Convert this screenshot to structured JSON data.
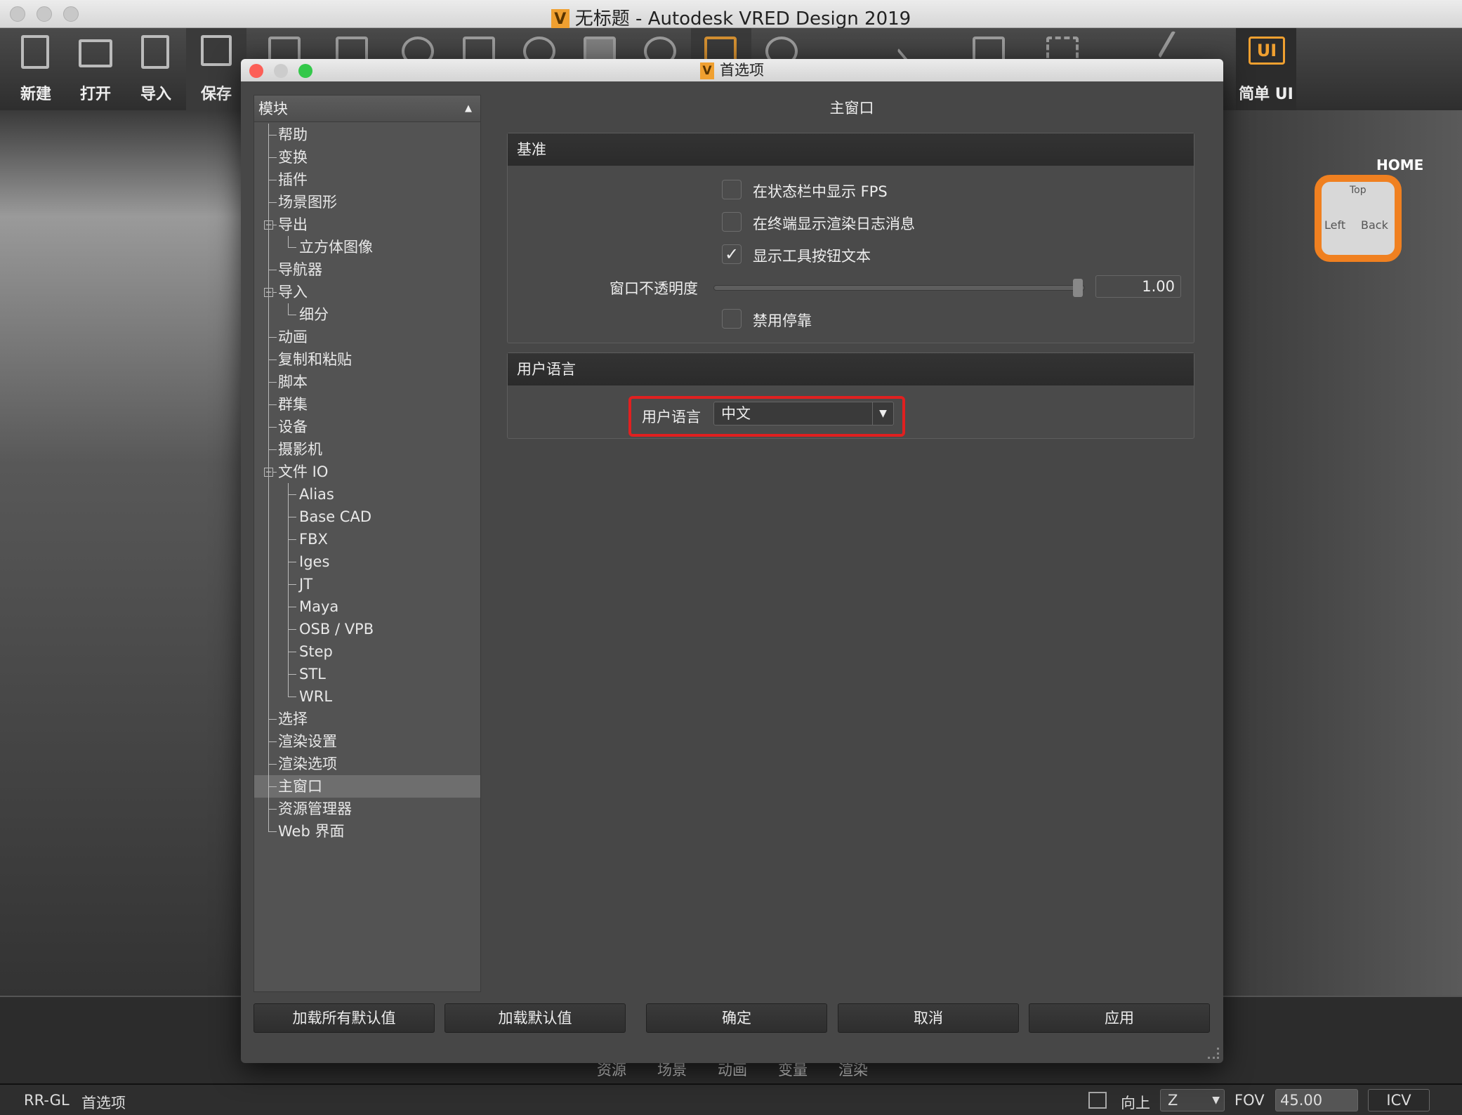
{
  "window": {
    "title": "无标题 - Autodesk VRED Design 2019",
    "logo": "V"
  },
  "toolbar": {
    "buttons": [
      {
        "label": "新建",
        "icon": "new-file-icon"
      },
      {
        "label": "打开",
        "icon": "folder-open-icon"
      },
      {
        "label": "导入",
        "icon": "import-icon"
      },
      {
        "label": "保存",
        "icon": "save-icon"
      }
    ],
    "simple_ui_label": "简单 UI",
    "simple_ui_icon": "UI"
  },
  "viewport": {
    "navcube_home": "HOME",
    "navcube_faces": [
      "Top",
      "Left",
      "Back"
    ]
  },
  "bottom_tabs": [
    "资源",
    "场景",
    "动画",
    "变量",
    "渲染"
  ],
  "status": {
    "renderer": "RR-GL",
    "message": "首选项",
    "up_label": "向上",
    "up_value": "Z",
    "fov_label": "FOV",
    "fov_value": "45.00",
    "icv": "ICV"
  },
  "dialog": {
    "title": "首选项",
    "tree": {
      "header": "模块",
      "items": [
        {
          "label": "帮助",
          "level": 0
        },
        {
          "label": "变换",
          "level": 0
        },
        {
          "label": "插件",
          "level": 0
        },
        {
          "label": "场景图形",
          "level": 0
        },
        {
          "label": "导出",
          "level": 0,
          "expanded": true
        },
        {
          "label": "立方体图像",
          "level": 1
        },
        {
          "label": "导航器",
          "level": 0
        },
        {
          "label": "导入",
          "level": 0,
          "expanded": true
        },
        {
          "label": "细分",
          "level": 1
        },
        {
          "label": "动画",
          "level": 0
        },
        {
          "label": "复制和粘贴",
          "level": 0
        },
        {
          "label": "脚本",
          "level": 0
        },
        {
          "label": "群集",
          "level": 0
        },
        {
          "label": "设备",
          "level": 0
        },
        {
          "label": "摄影机",
          "level": 0
        },
        {
          "label": "文件 IO",
          "level": 0,
          "expanded": true
        },
        {
          "label": "Alias",
          "level": 1
        },
        {
          "label": "Base CAD",
          "level": 1
        },
        {
          "label": "FBX",
          "level": 1
        },
        {
          "label": "Iges",
          "level": 1
        },
        {
          "label": "JT",
          "level": 1
        },
        {
          "label": "Maya",
          "level": 1
        },
        {
          "label": "OSB / VPB",
          "level": 1
        },
        {
          "label": "Step",
          "level": 1
        },
        {
          "label": "STL",
          "level": 1
        },
        {
          "label": "WRL",
          "level": 1
        },
        {
          "label": "选择",
          "level": 0
        },
        {
          "label": "渲染设置",
          "level": 0
        },
        {
          "label": "渲染选项",
          "level": 0
        },
        {
          "label": "主窗口",
          "level": 0,
          "selected": true
        },
        {
          "label": "资源管理器",
          "level": 0
        },
        {
          "label": "Web 界面",
          "level": 0
        }
      ]
    },
    "page_title": "主窗口",
    "basic": {
      "title": "基准",
      "show_fps": {
        "label": "在状态栏中显示 FPS",
        "checked": false
      },
      "terminal_log": {
        "label": "在终端显示渲染日志消息",
        "checked": false
      },
      "toolbar_text": {
        "label": "显示工具按钮文本",
        "checked": true
      },
      "opacity": {
        "label": "窗口不透明度",
        "value": "1.00",
        "fraction": 1.0
      },
      "disable_docking": {
        "label": "禁用停靠",
        "checked": false
      }
    },
    "language": {
      "title": "用户语言",
      "label": "用户语言",
      "value": "中文",
      "highlight_color": "#e02020"
    },
    "buttons": {
      "load_all": "加载所有默认值",
      "load_default": "加载默认值",
      "ok": "确定",
      "cancel": "取消",
      "apply": "应用"
    }
  }
}
